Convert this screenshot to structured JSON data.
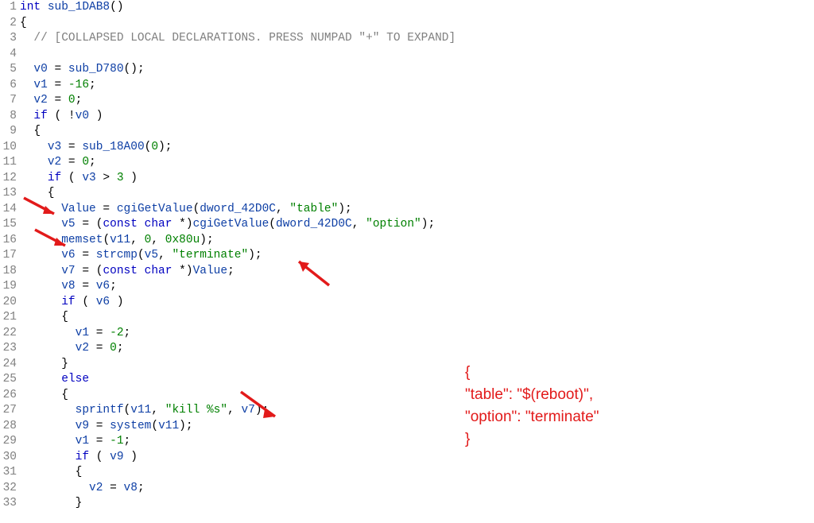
{
  "lines": [
    {
      "n": "1",
      "tokens": [
        [
          "kw",
          "int"
        ],
        [
          "plain",
          " "
        ],
        [
          "fn",
          "sub_1DAB8"
        ],
        [
          "plain",
          "()"
        ]
      ]
    },
    {
      "n": "2",
      "tokens": [
        [
          "plain",
          "{"
        ]
      ]
    },
    {
      "n": "3",
      "tokens": [
        [
          "plain",
          "  "
        ],
        [
          "com",
          "// [COLLAPSED LOCAL DECLARATIONS. PRESS NUMPAD \"+\" TO EXPAND]"
        ]
      ]
    },
    {
      "n": "4",
      "tokens": [
        [
          "plain",
          ""
        ]
      ]
    },
    {
      "n": "5",
      "tokens": [
        [
          "plain",
          "  "
        ],
        [
          "id",
          "v0"
        ],
        [
          "plain",
          " = "
        ],
        [
          "fn",
          "sub_D780"
        ],
        [
          "plain",
          "();"
        ]
      ]
    },
    {
      "n": "6",
      "tokens": [
        [
          "plain",
          "  "
        ],
        [
          "id",
          "v1"
        ],
        [
          "plain",
          " = "
        ],
        [
          "num",
          "-16"
        ],
        [
          "plain",
          ";"
        ]
      ]
    },
    {
      "n": "7",
      "tokens": [
        [
          "plain",
          "  "
        ],
        [
          "id",
          "v2"
        ],
        [
          "plain",
          " = "
        ],
        [
          "num",
          "0"
        ],
        [
          "plain",
          ";"
        ]
      ]
    },
    {
      "n": "8",
      "tokens": [
        [
          "plain",
          "  "
        ],
        [
          "kw",
          "if"
        ],
        [
          "plain",
          " ( !"
        ],
        [
          "id",
          "v0"
        ],
        [
          "plain",
          " )"
        ]
      ]
    },
    {
      "n": "9",
      "tokens": [
        [
          "plain",
          "  {"
        ]
      ]
    },
    {
      "n": "10",
      "tokens": [
        [
          "plain",
          "    "
        ],
        [
          "id",
          "v3"
        ],
        [
          "plain",
          " = "
        ],
        [
          "fn",
          "sub_18A00"
        ],
        [
          "plain",
          "("
        ],
        [
          "num",
          "0"
        ],
        [
          "plain",
          ");"
        ]
      ]
    },
    {
      "n": "11",
      "tokens": [
        [
          "plain",
          "    "
        ],
        [
          "id",
          "v2"
        ],
        [
          "plain",
          " = "
        ],
        [
          "num",
          "0"
        ],
        [
          "plain",
          ";"
        ]
      ]
    },
    {
      "n": "12",
      "tokens": [
        [
          "plain",
          "    "
        ],
        [
          "kw",
          "if"
        ],
        [
          "plain",
          " ( "
        ],
        [
          "id",
          "v3"
        ],
        [
          "plain",
          " > "
        ],
        [
          "num",
          "3"
        ],
        [
          "plain",
          " )"
        ]
      ]
    },
    {
      "n": "13",
      "tokens": [
        [
          "plain",
          "    {"
        ]
      ]
    },
    {
      "n": "14",
      "tokens": [
        [
          "plain",
          "      "
        ],
        [
          "id",
          "Value"
        ],
        [
          "plain",
          " = "
        ],
        [
          "fn",
          "cgiGetValue"
        ],
        [
          "plain",
          "("
        ],
        [
          "id",
          "dword_42D0C"
        ],
        [
          "plain",
          ", "
        ],
        [
          "lit",
          "\"table\""
        ],
        [
          "plain",
          ");"
        ]
      ]
    },
    {
      "n": "15",
      "tokens": [
        [
          "plain",
          "      "
        ],
        [
          "id",
          "v5"
        ],
        [
          "plain",
          " = ("
        ],
        [
          "kw",
          "const"
        ],
        [
          "plain",
          " "
        ],
        [
          "kw",
          "char"
        ],
        [
          "plain",
          " *)"
        ],
        [
          "fn",
          "cgiGetValue"
        ],
        [
          "plain",
          "("
        ],
        [
          "id",
          "dword_42D0C"
        ],
        [
          "plain",
          ", "
        ],
        [
          "lit",
          "\"option\""
        ],
        [
          "plain",
          ");"
        ]
      ]
    },
    {
      "n": "16",
      "tokens": [
        [
          "plain",
          "      "
        ],
        [
          "fn",
          "memset"
        ],
        [
          "plain",
          "("
        ],
        [
          "id",
          "v11"
        ],
        [
          "plain",
          ", "
        ],
        [
          "num",
          "0"
        ],
        [
          "plain",
          ", "
        ],
        [
          "num",
          "0x80u"
        ],
        [
          "plain",
          ");"
        ]
      ]
    },
    {
      "n": "17",
      "tokens": [
        [
          "plain",
          "      "
        ],
        [
          "id",
          "v6"
        ],
        [
          "plain",
          " = "
        ],
        [
          "fn",
          "strcmp"
        ],
        [
          "plain",
          "("
        ],
        [
          "id",
          "v5"
        ],
        [
          "plain",
          ", "
        ],
        [
          "lit",
          "\"terminate\""
        ],
        [
          "plain",
          ");"
        ]
      ]
    },
    {
      "n": "18",
      "tokens": [
        [
          "plain",
          "      "
        ],
        [
          "id",
          "v7"
        ],
        [
          "plain",
          " = ("
        ],
        [
          "kw",
          "const"
        ],
        [
          "plain",
          " "
        ],
        [
          "kw",
          "char"
        ],
        [
          "plain",
          " *)"
        ],
        [
          "id",
          "Value"
        ],
        [
          "plain",
          ";"
        ]
      ]
    },
    {
      "n": "19",
      "tokens": [
        [
          "plain",
          "      "
        ],
        [
          "id",
          "v8"
        ],
        [
          "plain",
          " = "
        ],
        [
          "id",
          "v6"
        ],
        [
          "plain",
          ";"
        ]
      ]
    },
    {
      "n": "20",
      "tokens": [
        [
          "plain",
          "      "
        ],
        [
          "kw",
          "if"
        ],
        [
          "plain",
          " ( "
        ],
        [
          "id",
          "v6"
        ],
        [
          "plain",
          " )"
        ]
      ]
    },
    {
      "n": "21",
      "tokens": [
        [
          "plain",
          "      {"
        ]
      ]
    },
    {
      "n": "22",
      "tokens": [
        [
          "plain",
          "        "
        ],
        [
          "id",
          "v1"
        ],
        [
          "plain",
          " = "
        ],
        [
          "num",
          "-2"
        ],
        [
          "plain",
          ";"
        ]
      ]
    },
    {
      "n": "23",
      "tokens": [
        [
          "plain",
          "        "
        ],
        [
          "id",
          "v2"
        ],
        [
          "plain",
          " = "
        ],
        [
          "num",
          "0"
        ],
        [
          "plain",
          ";"
        ]
      ]
    },
    {
      "n": "24",
      "tokens": [
        [
          "plain",
          "      }"
        ]
      ]
    },
    {
      "n": "25",
      "tokens": [
        [
          "plain",
          "      "
        ],
        [
          "kw",
          "else"
        ]
      ]
    },
    {
      "n": "26",
      "tokens": [
        [
          "plain",
          "      {"
        ]
      ]
    },
    {
      "n": "27",
      "tokens": [
        [
          "plain",
          "        "
        ],
        [
          "fn",
          "sprintf"
        ],
        [
          "plain",
          "("
        ],
        [
          "id",
          "v11"
        ],
        [
          "plain",
          ", "
        ],
        [
          "lit",
          "\"kill %s\""
        ],
        [
          "plain",
          ", "
        ],
        [
          "id",
          "v7"
        ],
        [
          "plain",
          ");"
        ]
      ]
    },
    {
      "n": "28",
      "tokens": [
        [
          "plain",
          "        "
        ],
        [
          "id",
          "v9"
        ],
        [
          "plain",
          " = "
        ],
        [
          "fn",
          "system"
        ],
        [
          "plain",
          "("
        ],
        [
          "id",
          "v11"
        ],
        [
          "plain",
          ");"
        ]
      ]
    },
    {
      "n": "29",
      "tokens": [
        [
          "plain",
          "        "
        ],
        [
          "id",
          "v1"
        ],
        [
          "plain",
          " = "
        ],
        [
          "num",
          "-1"
        ],
        [
          "plain",
          ";"
        ]
      ]
    },
    {
      "n": "30",
      "tokens": [
        [
          "plain",
          "        "
        ],
        [
          "kw",
          "if"
        ],
        [
          "plain",
          " ( "
        ],
        [
          "id",
          "v9"
        ],
        [
          "plain",
          " )"
        ]
      ]
    },
    {
      "n": "31",
      "tokens": [
        [
          "plain",
          "        {"
        ]
      ]
    },
    {
      "n": "32",
      "tokens": [
        [
          "plain",
          "          "
        ],
        [
          "id",
          "v2"
        ],
        [
          "plain",
          " = "
        ],
        [
          "id",
          "v8"
        ],
        [
          "plain",
          ";"
        ]
      ]
    },
    {
      "n": "33",
      "tokens": [
        [
          "plain",
          "        }"
        ]
      ]
    }
  ],
  "annotation": {
    "lines": [
      "{",
      "  \"table\": \"$(reboot)\",",
      "  \"option\": \"terminate\"",
      "}"
    ]
  }
}
